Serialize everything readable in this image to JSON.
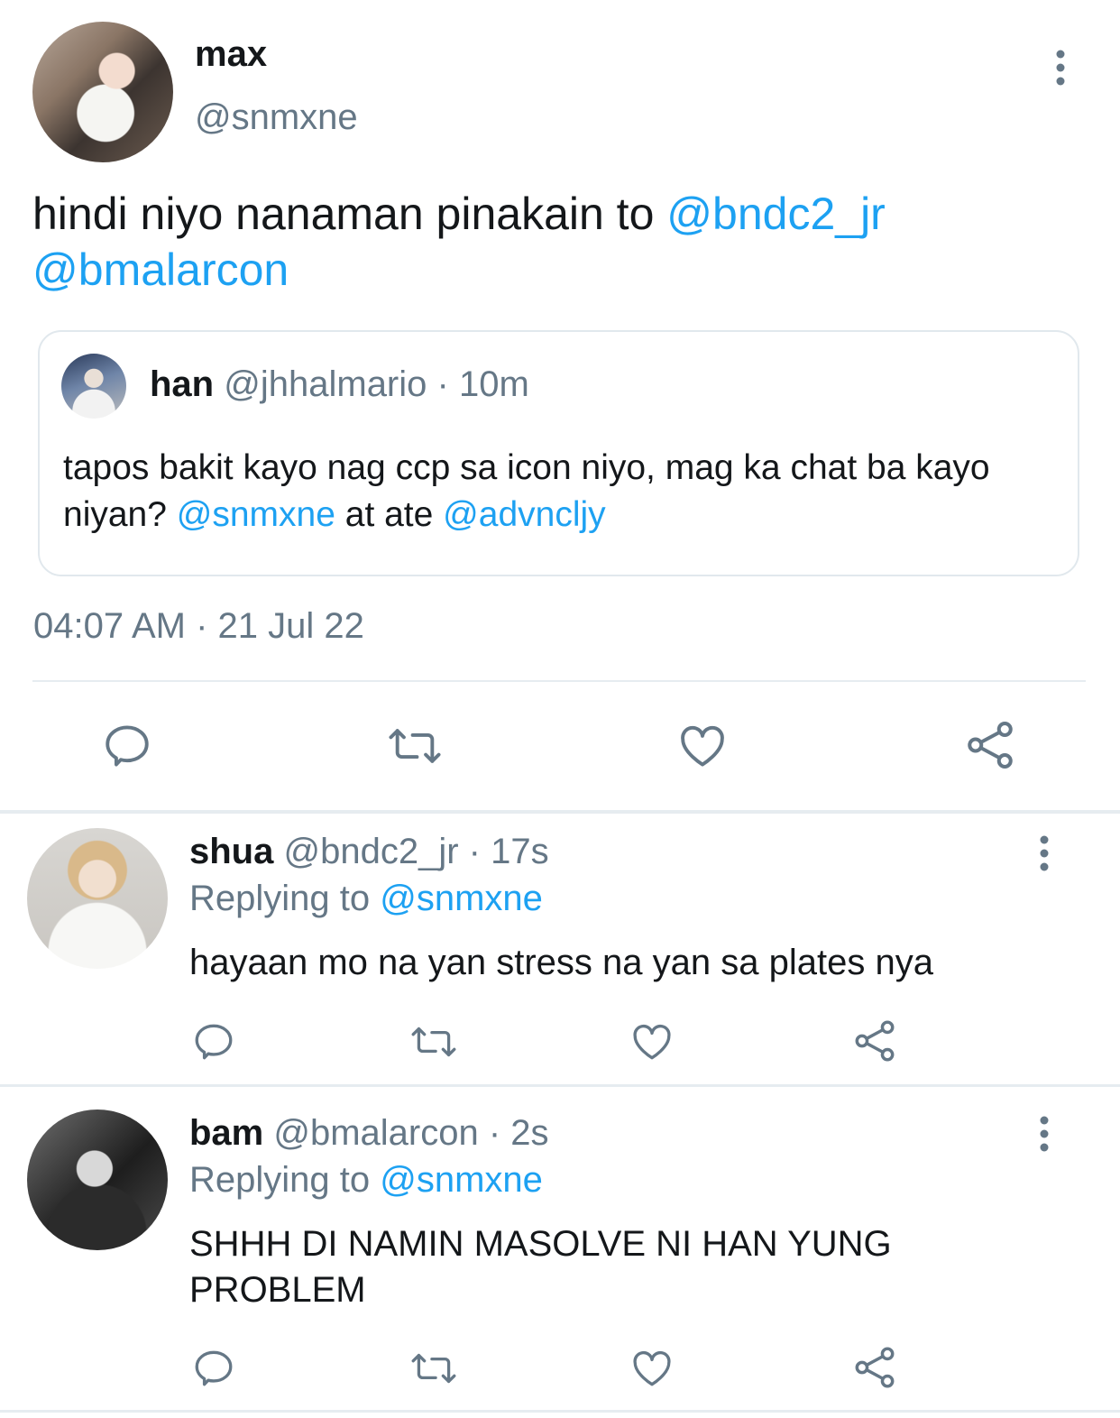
{
  "tweet": {
    "author": {
      "name": "max",
      "handle": "@snmxne"
    },
    "text_plain": "hindi niyo nanaman pinakain to ",
    "mention_1": "@bndc2_jr",
    "mention_2": "@bmalarcon",
    "timestamp": "04:07 AM · 21 Jul 22",
    "quoted": {
      "name": "han",
      "handle": "@jhhalmario",
      "time": "· 10m",
      "text_plain_1": "tapos bakit kayo nag ccp sa icon niyo, mag ka chat ba kayo niyan? ",
      "mention_1": "@snmxne",
      "text_plain_2": " at ate ",
      "mention_2": "@advncljy"
    }
  },
  "replies": [
    {
      "name": "shua",
      "handle": "@bndc2_jr",
      "time": "· 17s",
      "replying_label": "Replying to ",
      "replying_to": "@snmxne",
      "text": "hayaan mo na yan stress na yan sa plates nya"
    },
    {
      "name": "bam",
      "handle": "@bmalarcon",
      "time": "· 2s",
      "replying_label": "Replying to ",
      "replying_to": "@snmxne",
      "text": "SHHH DI NAMIN MASOLVE NI HAN YUNG PROBLEM"
    }
  ],
  "colors": {
    "link": "#1da1f2",
    "muted": "#657786",
    "divider": "#e6ecf0"
  },
  "icons": [
    "reply-icon",
    "retweet-icon",
    "like-icon",
    "share-icon",
    "more-icon"
  ]
}
